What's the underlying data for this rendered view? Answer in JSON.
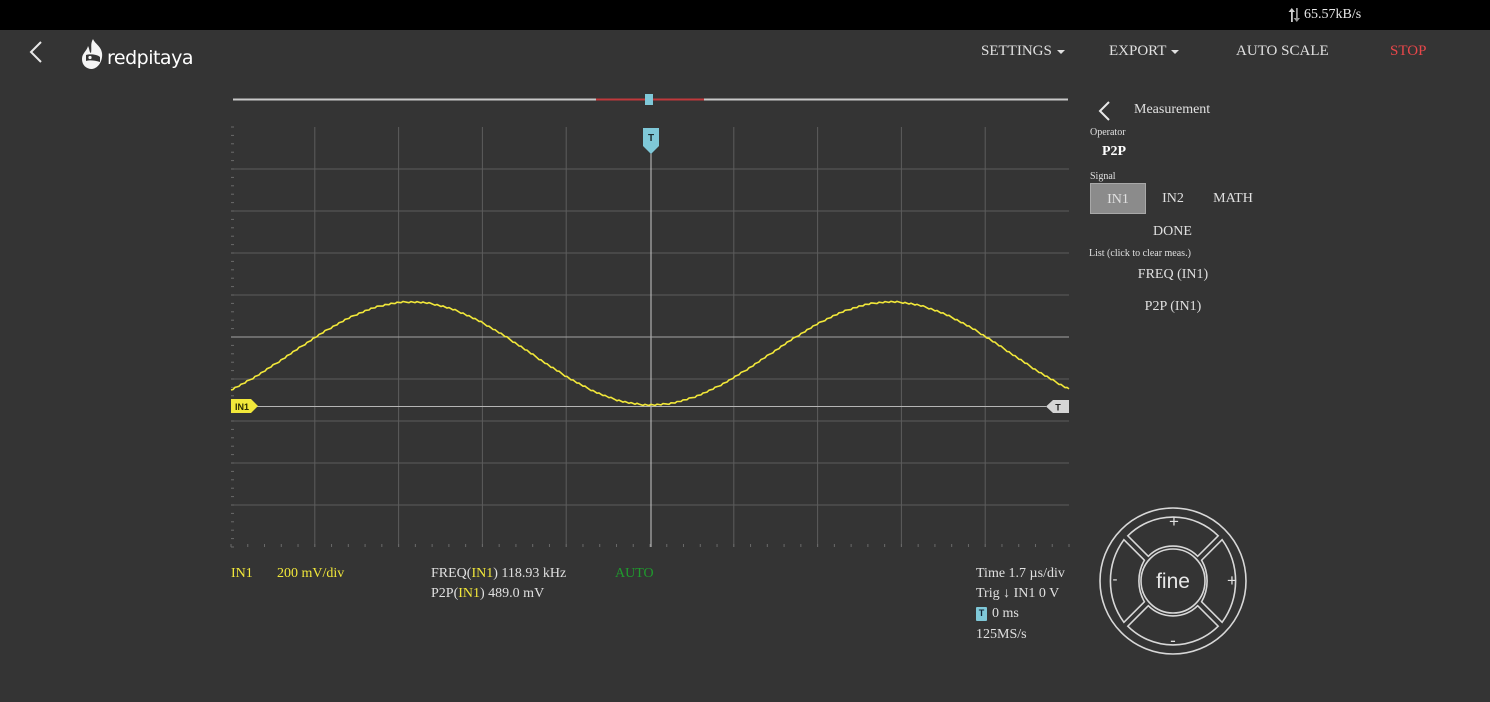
{
  "status_bar": {
    "transfer_speed": "65.57kB/s",
    "icon": "up-down-arrows-icon"
  },
  "header": {
    "back_icon": "chevron-left-icon",
    "logo_text": "redpitaya",
    "menu": {
      "settings": "SETTINGS",
      "export": "EXPORT",
      "auto_scale": "AUTO SCALE",
      "stop": "STOP"
    }
  },
  "scope": {
    "trigger_marker_label": "T",
    "channel_marker_label": "IN1",
    "trigger_level_marker_label": "T",
    "colors": {
      "trace": "#f2e83a",
      "trigger": "#7fc8d8",
      "window": "#c0393b",
      "grid": "#5c5c5c"
    }
  },
  "readouts": {
    "channel": "IN1",
    "scale": "200  mV/div",
    "freq_prefix": "FREQ(",
    "freq_channel": "IN1",
    "freq_value": ") 118.93  kHz",
    "p2p_prefix": "P2P(",
    "p2p_channel": "IN1",
    "p2p_value": ") 489.0  mV",
    "mode": "AUTO",
    "time": "Time  1.7  µs/div",
    "trig": "Trig ↓ IN1 0 V",
    "trig_offset_badge": "T",
    "trig_offset": "0 ms",
    "sample_rate": "125MS/s"
  },
  "measurement_panel": {
    "title": "Measurement",
    "operator_label": "Operator",
    "operator_value": "P2P",
    "signal_label": "Signal",
    "signals": [
      "IN1",
      "IN2",
      "MATH"
    ],
    "selected_signal": "IN1",
    "done": "DONE",
    "list_label": "List (click to clear  meas.)",
    "list": [
      "FREQ  (IN1)",
      "P2P  (IN1)"
    ]
  },
  "joystick": {
    "center": "fine",
    "up": "+",
    "down": "-",
    "left": "-",
    "right": "+"
  }
}
